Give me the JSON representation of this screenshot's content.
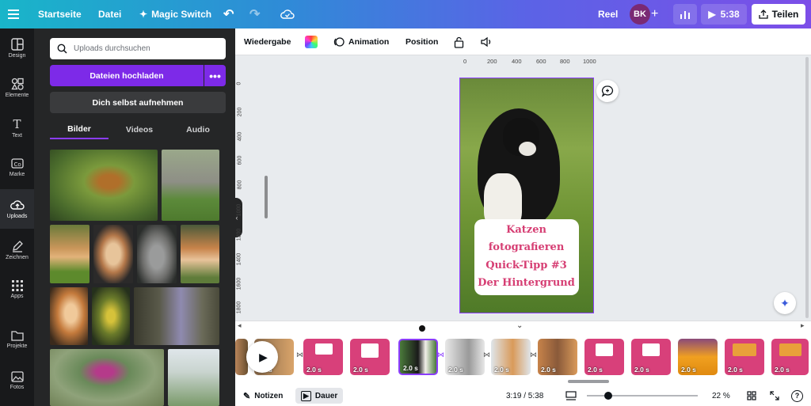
{
  "topbar": {
    "menu_icon": "hamburger-icon",
    "home": "Startseite",
    "file": "Datei",
    "magic_switch": "Magic Switch",
    "design_type": "Reel",
    "avatar_initials": "BK",
    "play_time": "5:38",
    "share": "Teilen"
  },
  "rail": {
    "items": [
      {
        "label": "Design",
        "icon": "layout-icon"
      },
      {
        "label": "Elemente",
        "icon": "shapes-icon"
      },
      {
        "label": "Text",
        "icon": "text-icon"
      },
      {
        "label": "Marke",
        "icon": "brand-icon"
      },
      {
        "label": "Uploads",
        "icon": "upload-cloud-icon"
      },
      {
        "label": "Zeichnen",
        "icon": "pen-icon"
      },
      {
        "label": "Apps",
        "icon": "apps-grid-icon"
      },
      {
        "label": "Projekte",
        "icon": "folder-icon"
      },
      {
        "label": "Fotos",
        "icon": "photo-icon"
      }
    ]
  },
  "panel": {
    "search_placeholder": "Uploads durchsuchen",
    "upload_button": "Dateien hochladen",
    "more_options": "•••",
    "record_button": "Dich selbst aufnehmen",
    "tabs": [
      "Bilder",
      "Videos",
      "Audio"
    ]
  },
  "toolbar": {
    "playback": "Wiedergabe",
    "animation": "Animation",
    "position": "Position"
  },
  "ruler": {
    "top_ticks": [
      "0",
      "200",
      "400",
      "600",
      "800",
      "1000"
    ],
    "left_ticks": [
      "0",
      "200",
      "400",
      "600",
      "800",
      "1000",
      "1200",
      "1400",
      "1600",
      "1800"
    ]
  },
  "canvas": {
    "caption_lines": [
      "Katzen",
      "fotografieren",
      "Quick-Tipp #3",
      "Der Hintergrund"
    ]
  },
  "timeline": {
    "clip_duration": "2.0 s",
    "clip_count": 12
  },
  "bottombar": {
    "notes": "Notizen",
    "duration": "Dauer",
    "time": "3:19 / 5:38",
    "zoom": "22 %",
    "help": "?"
  },
  "colors": {
    "accent": "#8b3dff",
    "upload_button": "#7d2ae8",
    "caption": "#d63e73",
    "clip_pink": "#d8407a"
  }
}
